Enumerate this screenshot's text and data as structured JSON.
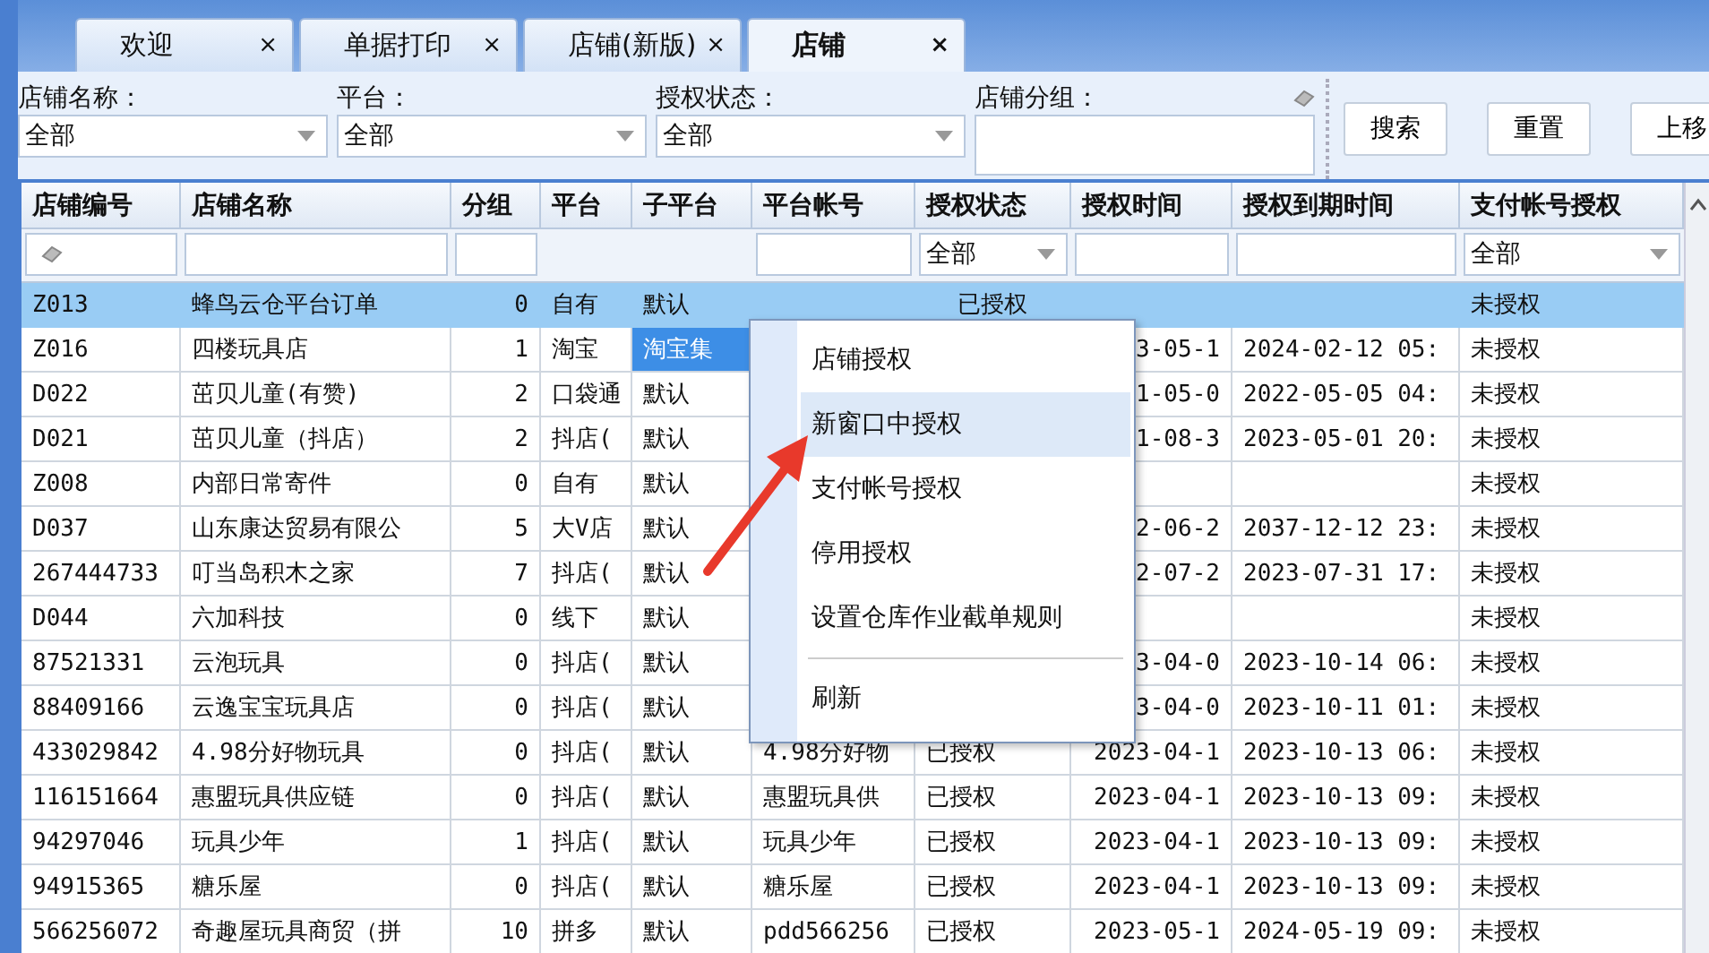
{
  "tabs": [
    {
      "label": "欢迎",
      "selected": false,
      "close": "×"
    },
    {
      "label": "单据打印",
      "selected": false,
      "close": "×"
    },
    {
      "label": "店铺(新版)",
      "selected": false,
      "close": "×"
    },
    {
      "label": "店铺",
      "selected": true,
      "close": "×"
    }
  ],
  "filters": [
    {
      "label": "店铺名称：",
      "kind": "dropdown",
      "value": "全部"
    },
    {
      "label": "平台：",
      "kind": "dropdown",
      "value": "全部"
    },
    {
      "label": "授权状态：",
      "kind": "dropdown",
      "value": "全部"
    },
    {
      "label": "店铺分组：",
      "kind": "text",
      "clearable": true
    }
  ],
  "buttons": [
    "搜索",
    "重置",
    "上移"
  ],
  "table": {
    "columns": [
      {
        "label": "店铺编号",
        "filter": {
          "kind": "clearable"
        }
      },
      {
        "label": "店铺名称",
        "filter": {
          "kind": "text"
        }
      },
      {
        "label": "分组",
        "filter": {
          "kind": "text"
        }
      },
      {
        "label": "平台"
      },
      {
        "label": "子平台"
      },
      {
        "label": "平台帐号",
        "filter": {
          "kind": "text"
        }
      },
      {
        "label": "授权状态",
        "filter": {
          "kind": "dropdown",
          "value": "全部"
        }
      },
      {
        "label": "授权时间",
        "filter": {
          "kind": "text"
        }
      },
      {
        "label": "授权到期时间",
        "filter": {
          "kind": "text"
        }
      },
      {
        "label": "支付帐号授权",
        "filter": {
          "kind": "dropdown",
          "value": "全部"
        }
      }
    ],
    "rows": [
      {
        "id": "Z013",
        "name": "蜂鸟云仓平台订单",
        "group": "0",
        "platform": "自有",
        "sub_platform": "默认",
        "sub_platform_selected": false,
        "account": "",
        "status": "已授权",
        "auth_time": "",
        "expiry": "",
        "pay_auth": "未授权",
        "selected": true
      },
      {
        "id": "Z016",
        "name": "四楼玩具店",
        "group": "1",
        "platform": "淘宝",
        "sub_platform": "淘宝集",
        "sub_platform_selected": true,
        "account": "",
        "status": "",
        "auth_time": "3-05-1",
        "expiry": "2024-02-12 05:",
        "pay_auth": "未授权",
        "selected": false
      },
      {
        "id": "D022",
        "name": "茁贝儿童(有赞)",
        "group": "2",
        "platform": "口袋通",
        "sub_platform": "默认",
        "sub_platform_selected": false,
        "account": "",
        "status": "",
        "auth_time": "1-05-0",
        "expiry": "2022-05-05 04:",
        "pay_auth": "未授权",
        "selected": false
      },
      {
        "id": "D021",
        "name": "茁贝儿童（抖店）",
        "group": "2",
        "platform": "抖店(",
        "sub_platform": "默认",
        "sub_platform_selected": false,
        "account": "",
        "status": "",
        "auth_time": "1-08-3",
        "expiry": "2023-05-01 20:",
        "pay_auth": "未授权",
        "selected": false
      },
      {
        "id": "Z008",
        "name": "内部日常寄件",
        "group": "0",
        "platform": "自有",
        "sub_platform": "默认",
        "sub_platform_selected": false,
        "account": "",
        "status": "",
        "auth_time": "",
        "expiry": "",
        "pay_auth": "未授权",
        "selected": false
      },
      {
        "id": "D037",
        "name": "山东康达贸易有限公",
        "group": "5",
        "platform": "大V店",
        "sub_platform": "默认",
        "sub_platform_selected": false,
        "account": "",
        "status": "",
        "auth_time": "2-06-2",
        "expiry": "2037-12-12 23:",
        "pay_auth": "未授权",
        "selected": false
      },
      {
        "id": "267444733",
        "name": "叮当岛积木之家",
        "group": "7",
        "platform": "抖店(",
        "sub_platform": "默认",
        "sub_platform_selected": false,
        "account": "",
        "status": "",
        "auth_time": "2-07-2",
        "expiry": "2023-07-31 17:",
        "pay_auth": "未授权",
        "selected": false
      },
      {
        "id": "D044",
        "name": "六加科技",
        "group": "0",
        "platform": "线下",
        "sub_platform": "默认",
        "sub_platform_selected": false,
        "account": "",
        "status": "",
        "auth_time": "",
        "expiry": "",
        "pay_auth": "未授权",
        "selected": false
      },
      {
        "id": "87521331",
        "name": "云泡玩具",
        "group": "0",
        "platform": "抖店(",
        "sub_platform": "默认",
        "sub_platform_selected": false,
        "account": "",
        "status": "",
        "auth_time": "3-04-0",
        "expiry": "2023-10-14 06:",
        "pay_auth": "未授权",
        "selected": false
      },
      {
        "id": "88409166",
        "name": "云逸宝宝玩具店",
        "group": "0",
        "platform": "抖店(",
        "sub_platform": "默认",
        "sub_platform_selected": false,
        "account": "",
        "status": "",
        "auth_time": "3-04-0",
        "expiry": "2023-10-11 01:",
        "pay_auth": "未授权",
        "selected": false
      },
      {
        "id": "433029842",
        "name": "4.98分好物玩具",
        "group": "0",
        "platform": "抖店(",
        "sub_platform": "默认",
        "sub_platform_selected": false,
        "account": "4.98分好物",
        "status": "已授权",
        "auth_time": "2023-04-1",
        "expiry": "2023-10-13 06:",
        "pay_auth": "未授权",
        "selected": false
      },
      {
        "id": "116151664",
        "name": "惠盟玩具供应链",
        "group": "0",
        "platform": "抖店(",
        "sub_platform": "默认",
        "sub_platform_selected": false,
        "account": "惠盟玩具供",
        "status": "已授权",
        "auth_time": "2023-04-1",
        "expiry": "2023-10-13 09:",
        "pay_auth": "未授权",
        "selected": false
      },
      {
        "id": "94297046",
        "name": "玩具少年",
        "group": "1",
        "platform": "抖店(",
        "sub_platform": "默认",
        "sub_platform_selected": false,
        "account": "玩具少年",
        "status": "已授权",
        "auth_time": "2023-04-1",
        "expiry": "2023-10-13 09:",
        "pay_auth": "未授权",
        "selected": false
      },
      {
        "id": "94915365",
        "name": "糖乐屋",
        "group": "0",
        "platform": "抖店(",
        "sub_platform": "默认",
        "sub_platform_selected": false,
        "account": "糖乐屋",
        "status": "已授权",
        "auth_time": "2023-04-1",
        "expiry": "2023-10-13 09:",
        "pay_auth": "未授权",
        "selected": false
      },
      {
        "id": "566256072",
        "name": "奇趣屋玩具商贸（拼",
        "group": "10",
        "platform": "拼多",
        "sub_platform": "默认",
        "sub_platform_selected": false,
        "account": "pdd566256",
        "status": "已授权",
        "auth_time": "2023-05-1",
        "expiry": "2024-05-19 09:",
        "pay_auth": "未授权",
        "selected": false
      }
    ]
  },
  "context_menu": {
    "items": [
      {
        "label": "店铺授权",
        "selected": false,
        "separator_before": false
      },
      {
        "label": "新窗口中授权",
        "selected": true,
        "separator_before": false
      },
      {
        "label": "支付帐号授权",
        "selected": false,
        "separator_before": false
      },
      {
        "label": "停用授权",
        "selected": false,
        "separator_before": false
      },
      {
        "label": "设置仓库作业截单规则",
        "selected": false,
        "separator_before": false
      },
      {
        "label": "刷新",
        "selected": false,
        "separator_before": true
      }
    ]
  }
}
